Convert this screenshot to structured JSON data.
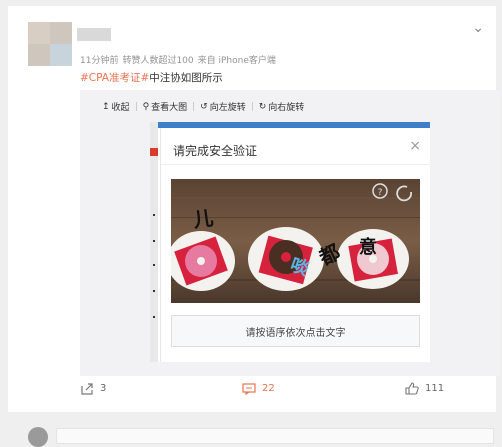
{
  "post": {
    "meta": {
      "time": "11分钟前",
      "likes_note": "转赞人数超过100",
      "source": "来自 iPhone客户端"
    },
    "text": {
      "tag": "#CPA准考证#",
      "body": "中注协如图所示"
    }
  },
  "toolbar": {
    "collapse": "收起",
    "view_large": "查看大图",
    "rotate_left": "向左旋转",
    "rotate_right": "向右旋转"
  },
  "captcha": {
    "title": "请完成安全验证",
    "instruction": "请按语序依次点击文字",
    "chars": [
      "儿",
      "啖",
      "都",
      "意"
    ]
  },
  "actions": {
    "forward_count": "3",
    "comment_count": "22",
    "like_count": "111"
  },
  "colors": {
    "accent": "#eb7350",
    "background": "#efefef"
  }
}
